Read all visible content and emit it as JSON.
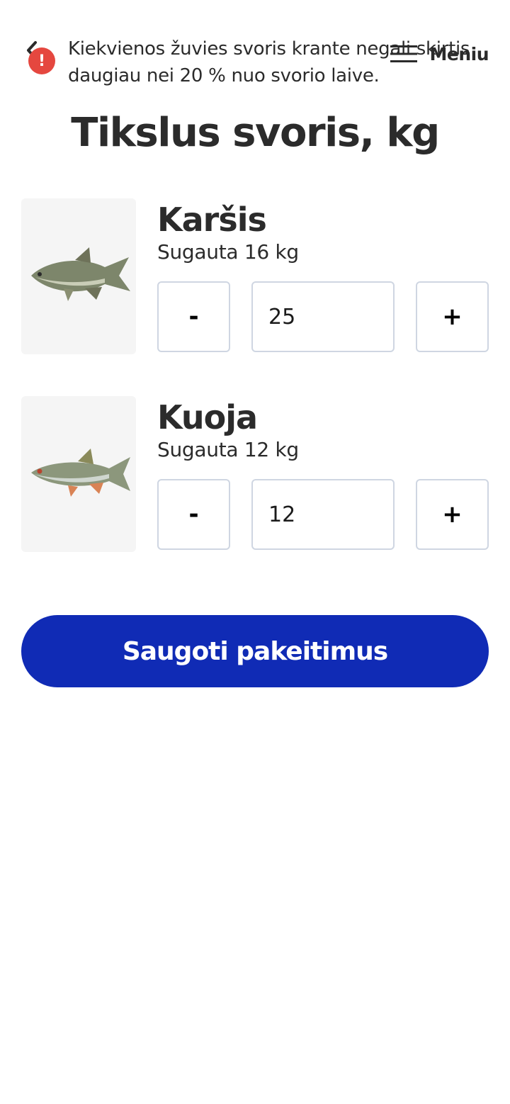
{
  "header": {
    "menu_label": "Meniu",
    "alert_text": "Kiekvienos žuvies svoris krante negali skirtis daugiau nei 20 % nuo svorio laive."
  },
  "page_title": "Tikslus svoris, kg",
  "fish": [
    {
      "name": "Karšis",
      "caught": "Sugauta 16 kg",
      "weight": "25",
      "minus_label": "-",
      "plus_label": "+"
    },
    {
      "name": "Kuoja",
      "caught": "Sugauta 12 kg",
      "weight": "12",
      "minus_label": "-",
      "plus_label": "+"
    }
  ],
  "save_label": "Saugoti pakeitimus",
  "colors": {
    "primary": "#102bb5",
    "alert": "#e5473f",
    "text": "#2b2b2b",
    "input_border": "#cfd6e2"
  },
  "icons": {
    "back": "chevron-left-icon",
    "menu": "hamburger-menu-icon",
    "alert": "exclamation-circle-icon"
  }
}
